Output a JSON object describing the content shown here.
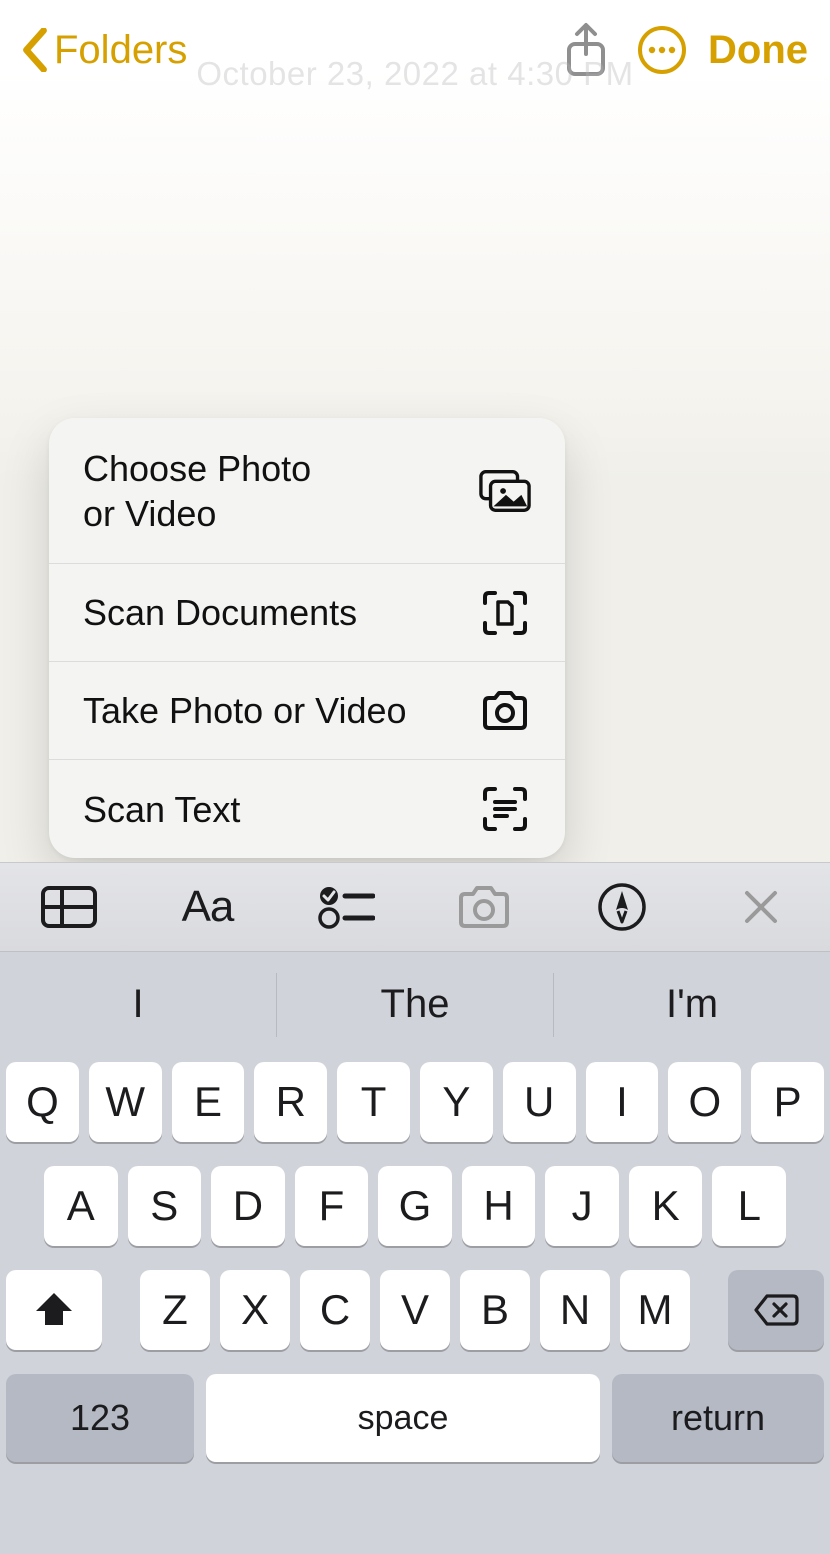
{
  "nav": {
    "back_label": "Folders",
    "done_label": "Done"
  },
  "note": {
    "timestamp": "October 23, 2022 at 4:30 PM"
  },
  "menu": {
    "items": [
      {
        "label": "Choose Photo\nor Video",
        "icon": "photo-library-icon"
      },
      {
        "label": "Scan Documents",
        "icon": "scan-document-icon"
      },
      {
        "label": "Take Photo or Video",
        "icon": "camera-icon"
      },
      {
        "label": "Scan Text",
        "icon": "scan-text-icon"
      }
    ]
  },
  "format_bar": {
    "buttons": [
      {
        "name": "table-button",
        "icon": "table-icon"
      },
      {
        "name": "text-style-button",
        "icon": "aa-icon",
        "label": "Aa"
      },
      {
        "name": "checklist-button",
        "icon": "checklist-icon"
      },
      {
        "name": "camera-button",
        "icon": "camera-icon"
      },
      {
        "name": "markup-button",
        "icon": "markup-icon"
      },
      {
        "name": "close-keyboard-button",
        "icon": "close-icon"
      }
    ]
  },
  "keyboard": {
    "suggestions": [
      "I",
      "The",
      "I'm"
    ],
    "rows": {
      "r1": [
        "Q",
        "W",
        "E",
        "R",
        "T",
        "Y",
        "U",
        "I",
        "O",
        "P"
      ],
      "r2": [
        "A",
        "S",
        "D",
        "F",
        "G",
        "H",
        "J",
        "K",
        "L"
      ],
      "r3": [
        "Z",
        "X",
        "C",
        "V",
        "B",
        "N",
        "M"
      ]
    },
    "numbers_label": "123",
    "space_label": "space",
    "return_label": "return"
  }
}
